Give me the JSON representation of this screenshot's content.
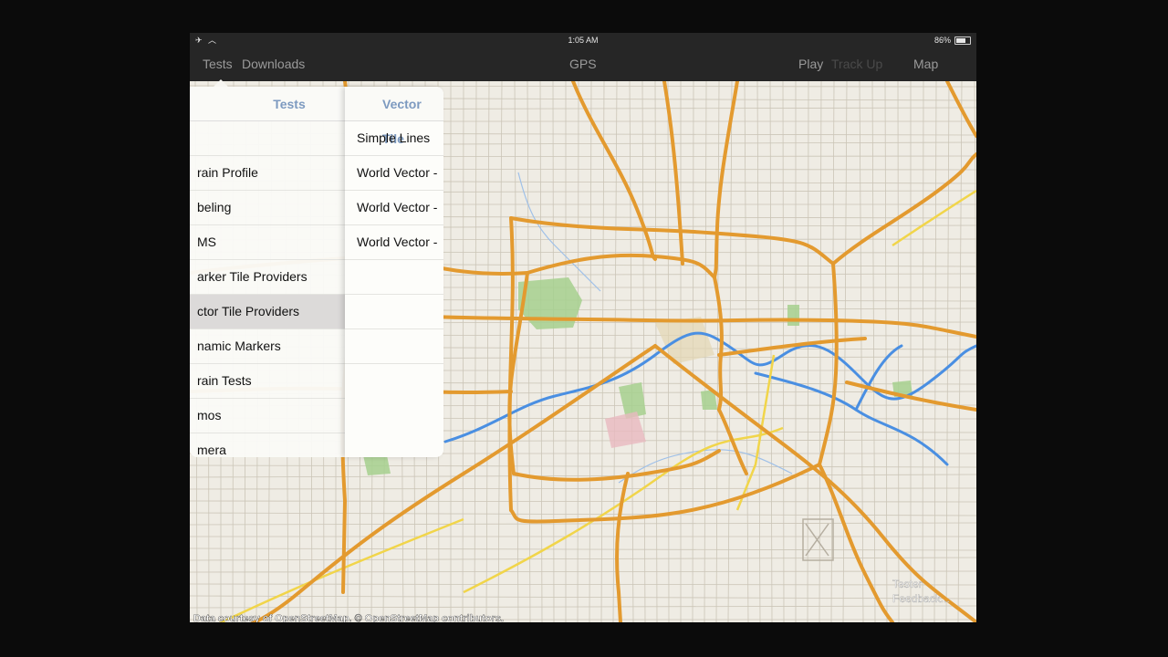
{
  "status_bar": {
    "time": "1:05 AM",
    "battery": "86%",
    "battery_level": 0.86
  },
  "nav": {
    "tests_tab": "Tests",
    "downloads_tab": "Downloads",
    "title": "GPS",
    "play": "Play",
    "track_up": "Track Up",
    "map": "Map"
  },
  "popover": {
    "left_header": "Tests",
    "left_items": [
      "",
      "rain Profile",
      "beling",
      "MS",
      "arker Tile Providers",
      "ctor Tile Providers",
      "namic Markers",
      "rain Tests",
      "mos",
      "mera"
    ],
    "selected_index": 5,
    "right_header": "Vector Tile",
    "right_items": [
      "Simple Lines",
      "World Vector -",
      "World Vector -",
      "World Vector -"
    ]
  },
  "map": {
    "attribution": "Data courtesy of OpenStreetMap. © OpenStreetMap contributors.",
    "feedback_line1": "Tester",
    "feedback_line2": "Feedback...",
    "colors": {
      "land": "#efece4",
      "highway": "#e39a2f",
      "arterial": "#f1d54a",
      "water": "#4a8fe2",
      "park": "#a6d08e",
      "street": "#c8c2b4"
    }
  }
}
